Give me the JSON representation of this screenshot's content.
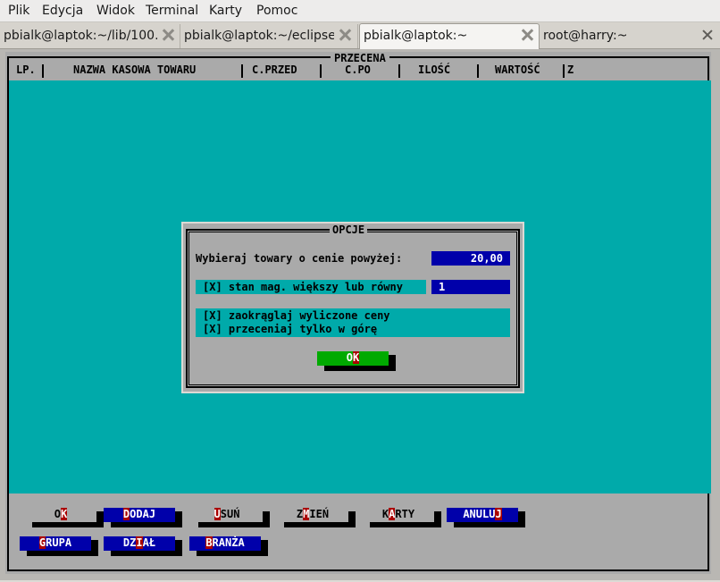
{
  "menubar": {
    "items": [
      "Plik",
      "Edycja",
      "Widok",
      "Terminal",
      "Karty",
      "Pomoc"
    ]
  },
  "tabs": [
    {
      "label": "pbialk@laptok:~/lib/100…",
      "active": false
    },
    {
      "label": "pbialk@laptok:~/eclipse",
      "active": false
    },
    {
      "label": "pbialk@laptok:~",
      "active": true
    },
    {
      "label": "root@harry:~",
      "active": false
    }
  ],
  "screen": {
    "title": "PRZECENA",
    "columns": [
      "LP.",
      "NAZWA KASOWA TOWARU",
      "C.PRZED",
      "C.PO",
      "ILOŚĆ",
      "WARTOŚĆ",
      "Z"
    ]
  },
  "dialog": {
    "title": "OPCJE",
    "price_label": "Wybieraj towary o cenie powyżej:",
    "price_value": "20,00",
    "stock_checkbox_label": "[X] stan mag. większy lub równy",
    "stock_value": "1",
    "round_checkbox_label": "[X] zaokrąglaj wyliczone ceny",
    "up_only_checkbox_label": "[X] przeceniaj tylko w górę",
    "ok_label": "OK"
  },
  "buttons_row1": [
    {
      "label": "OK",
      "hot_index": 1,
      "style": "grey"
    },
    {
      "label": "DODAJ",
      "hot_index": 0,
      "style": "blue"
    },
    {
      "label": "USUŃ",
      "hot_index": 0,
      "style": "grey"
    },
    {
      "label": "ZMIEŃ",
      "hot_index": 1,
      "style": "grey"
    },
    {
      "label": "KARTY",
      "hot_index": 1,
      "style": "grey"
    },
    {
      "label": "ANULUJ",
      "hot_index": 5,
      "style": "blue"
    }
  ],
  "buttons_row2": [
    {
      "label": "GRUPA",
      "hot_index": 0,
      "style": "blue"
    },
    {
      "label": "DZIAŁ",
      "hot_index": 2,
      "style": "blue"
    },
    {
      "label": "BRANŻA",
      "hot_index": 0,
      "style": "blue"
    }
  ],
  "colors": {
    "terminal_bg": "#aaaaaa",
    "cyan": "#00aaaa",
    "blue": "#0000aa",
    "green": "#00aa00",
    "hotkey": "#aa0000"
  }
}
